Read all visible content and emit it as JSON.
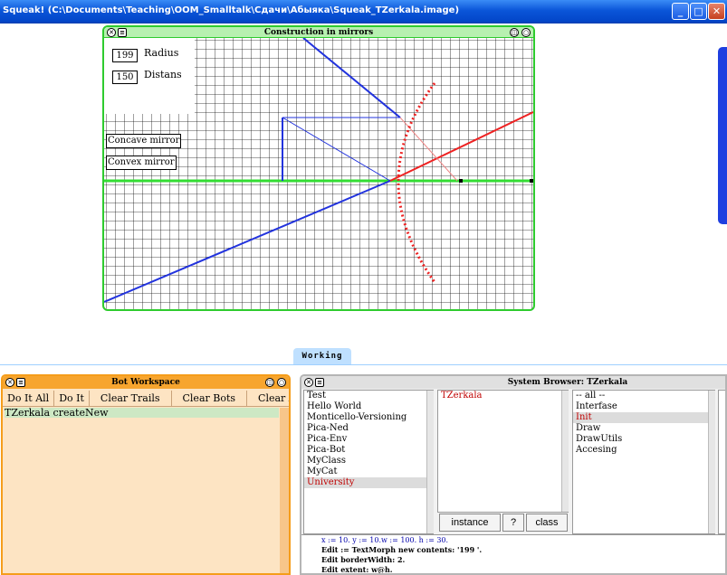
{
  "window": {
    "title": "Squeak! (C:\\Documents\\Teaching\\OOM_Smalltalk\\Сдачи\\Абыяка\\Squeak_TZerkala.image)"
  },
  "construction": {
    "title": "Construction in mirrors",
    "radius_value": "199",
    "radius_label": "Radius",
    "distance_value": "150",
    "distance_label": "Distans",
    "concave_label": "Concave mirror",
    "convex_label": "Convex mirror"
  },
  "working_tab": {
    "label": "Working"
  },
  "bot_workspace": {
    "title": "Bot Workspace",
    "buttons": [
      "Do It All",
      "Do It",
      "Clear Trails",
      "Clear Bots",
      "Clear All"
    ],
    "code": "TZerkala createNew"
  },
  "system_browser": {
    "title": "System Browser: TZerkala",
    "categories": [
      "Test",
      "Hello World",
      "Monticello-Versioning",
      "Pica-Ned",
      "Pica-Env",
      "Pica-Bot",
      "MyClass",
      "MyCat",
      "University"
    ],
    "classes": [
      "TZerkala"
    ],
    "protocols": [
      "-- all --",
      "Interfase",
      "Init",
      "Draw",
      "DrawUtils",
      "Accesing"
    ],
    "instance_label": "instance",
    "help_label": "?",
    "class_label": "class",
    "code_lines": [
      "x := 10. y := 10.w := 100. h := 30.",
      "Edit := TextMorph new contents: '199 '.",
      "Edit borderWidth: 2.",
      "Edit extent: w@h."
    ]
  },
  "colors": {
    "titlebar": "#0a55d8",
    "construction_border": "#2ecb2e",
    "bot_border": "#f59d1a",
    "axis_green": "#33dd33",
    "ray_blue": "#2233dd",
    "ray_red": "#ee2222"
  }
}
